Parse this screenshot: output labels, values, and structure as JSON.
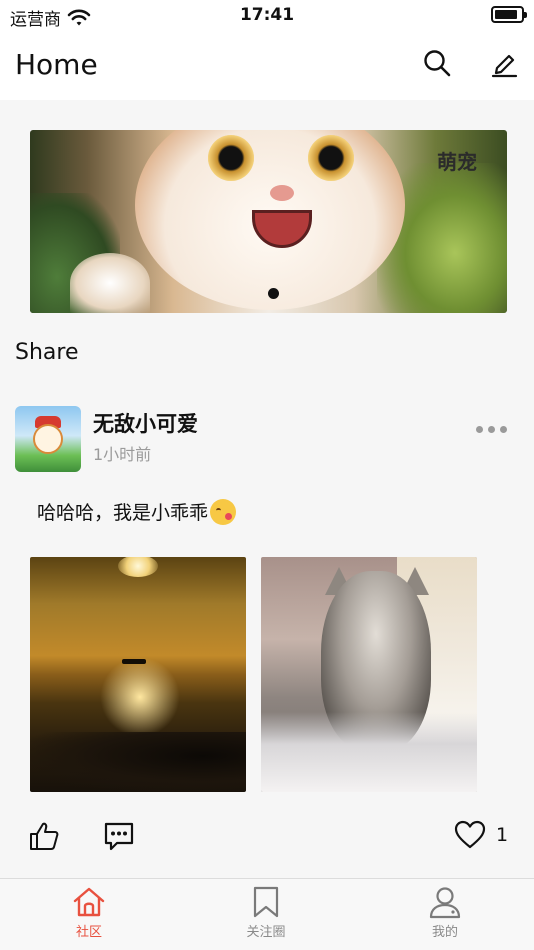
{
  "status_bar": {
    "carrier": "运营商",
    "time": "17:41",
    "battery_level": 0.9
  },
  "header": {
    "title": "Home",
    "search_icon": "search-icon",
    "edit_icon": "pencil-icon"
  },
  "banner": {
    "label": "萌宠",
    "page_index": 1,
    "page_count": 1
  },
  "section": {
    "title": "Share"
  },
  "post": {
    "username": "无敌小可爱",
    "time_ago": "1小时前",
    "text": "哈哈哈，我是小乖乖",
    "emoji": "kissing-face-emoji",
    "image_count": 2,
    "images": [
      "sunset-sea-photo",
      "kitten-photo"
    ],
    "favorite_count": "1"
  },
  "tabbar": {
    "items": [
      {
        "label": "社区",
        "icon": "home-icon",
        "active": true
      },
      {
        "label": "关注圈",
        "icon": "bookmark-icon",
        "active": false
      },
      {
        "label": "我的",
        "icon": "user-icon",
        "active": false
      }
    ],
    "active_color": "#e8513f",
    "inactive_color": "#8a8a8a"
  }
}
